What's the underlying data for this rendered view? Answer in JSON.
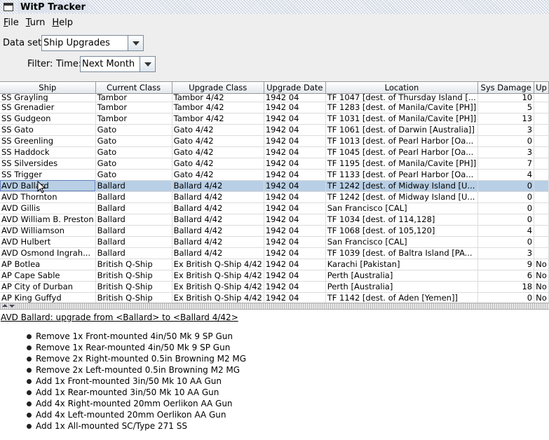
{
  "window": {
    "title": "WitP Tracker"
  },
  "menu": [
    "File",
    "Turn",
    "Help"
  ],
  "dataset": {
    "label": "Data set:",
    "value": "Ship Upgrades"
  },
  "filter": {
    "label": "Filter:",
    "time_label": "Time:",
    "time_value": "Next Month"
  },
  "table": {
    "columns": [
      "Ship",
      "Current Class",
      "Upgrade Class",
      "Upgrade Date",
      "Location",
      "Sys Damage",
      "Up"
    ],
    "rows": [
      [
        "SS Grayling",
        "Tambor",
        "Tambor 4/42",
        "1942 04",
        "TF 1047 [dest. of Thursday Island [...",
        "10",
        ""
      ],
      [
        "SS Grenadier",
        "Tambor",
        "Tambor 4/42",
        "1942 04",
        "TF 1283 [dest. of Manila/Cavite [PH]]",
        "5",
        ""
      ],
      [
        "SS Gudgeon",
        "Tambor",
        "Tambor 4/42",
        "1942 04",
        "TF 1031 [dest. of Manila/Cavite [PH]]",
        "13",
        ""
      ],
      [
        "SS Gato",
        "Gato",
        "Gato 4/42",
        "1942 04",
        "TF 1061 [dest. of Darwin [Australia]]",
        "3",
        ""
      ],
      [
        "SS Greenling",
        "Gato",
        "Gato 4/42",
        "1942 04",
        "TF 1013 [dest. of Pearl Harbor [Oa...",
        "0",
        ""
      ],
      [
        "SS Haddock",
        "Gato",
        "Gato 4/42",
        "1942 04",
        "TF 1045 [dest. of Pearl Harbor [Oa...",
        "3",
        ""
      ],
      [
        "SS Silversides",
        "Gato",
        "Gato 4/42",
        "1942 04",
        "TF 1195 [dest. of Manila/Cavite [PH]]",
        "7",
        ""
      ],
      [
        "SS Trigger",
        "Gato",
        "Gato 4/42",
        "1942 04",
        "TF 1133 [dest. of Pearl Harbor [Oa...",
        "4",
        ""
      ],
      [
        "AVD Ballard",
        "Ballard",
        "Ballard 4/42",
        "1942 04",
        "TF 1242 [dest. of Midway Island [U...",
        "0",
        ""
      ],
      [
        "AVD Thornton",
        "Ballard",
        "Ballard 4/42",
        "1942 04",
        "TF 1242 [dest. of Midway Island [U...",
        "0",
        ""
      ],
      [
        "AVD Gillis",
        "Ballard",
        "Ballard 4/42",
        "1942 04",
        "San Francisco [CAL]",
        "0",
        ""
      ],
      [
        "AVD William B. Preston",
        "Ballard",
        "Ballard 4/42",
        "1942 04",
        "TF 1034 [dest. of 114,128]",
        "0",
        ""
      ],
      [
        "AVD Williamson",
        "Ballard",
        "Ballard 4/42",
        "1942 04",
        "TF 1068 [dest. of 105,120]",
        "4",
        ""
      ],
      [
        "AVD Hulbert",
        "Ballard",
        "Ballard 4/42",
        "1942 04",
        "San Francisco [CAL]",
        "0",
        ""
      ],
      [
        "AVD Osmond Ingrah...",
        "Ballard",
        "Ballard 4/42",
        "1942 04",
        "TF 1039 [dest. of Baltra Island [PA...",
        "3",
        ""
      ],
      [
        "AP Botlea",
        "British Q-Ship",
        "Ex British Q-Ship 4/42",
        "1942 04",
        "Karachi [Pakistan]",
        "9",
        "No"
      ],
      [
        "AP Cape Sable",
        "British Q-Ship",
        "Ex British Q-Ship 4/42",
        "1942 04",
        "Perth [Australia]",
        "6",
        "No"
      ],
      [
        "AP City of Durban",
        "British Q-Ship",
        "Ex British Q-Ship 4/42",
        "1942 04",
        "Perth [Australia]",
        "18",
        "No"
      ],
      [
        "AP King Guffyd",
        "British Q-Ship",
        "Ex British Q-Ship 4/42",
        "1942 04",
        "TF 1142 [dest. of Aden [Yemen]]",
        "0",
        "No"
      ]
    ],
    "selected_index": 8
  },
  "detail": {
    "heading": "AVD Ballard: upgrade from <Ballard> to <Ballard 4/42>",
    "items": [
      "Remove 1x Front-mounted 4in/50 Mk 9 SP Gun",
      "Remove 1x Rear-mounted 4in/50 Mk 9 SP Gun",
      "Remove 2x Right-mounted 0.5in Browning M2 MG",
      "Remove 2x Left-mounted 0.5in Browning M2 MG",
      "Add 1x Front-mounted 3in/50 Mk 10 AA Gun",
      "Add 1x Rear-mounted 3in/50 Mk 10 AA Gun",
      "Add 4x Right-mounted 20mm Oerlikon AA Gun",
      "Add 4x Left-mounted 20mm Oerlikon AA Gun",
      "Add 1x All-mounted SC/Type 271 SS"
    ]
  }
}
